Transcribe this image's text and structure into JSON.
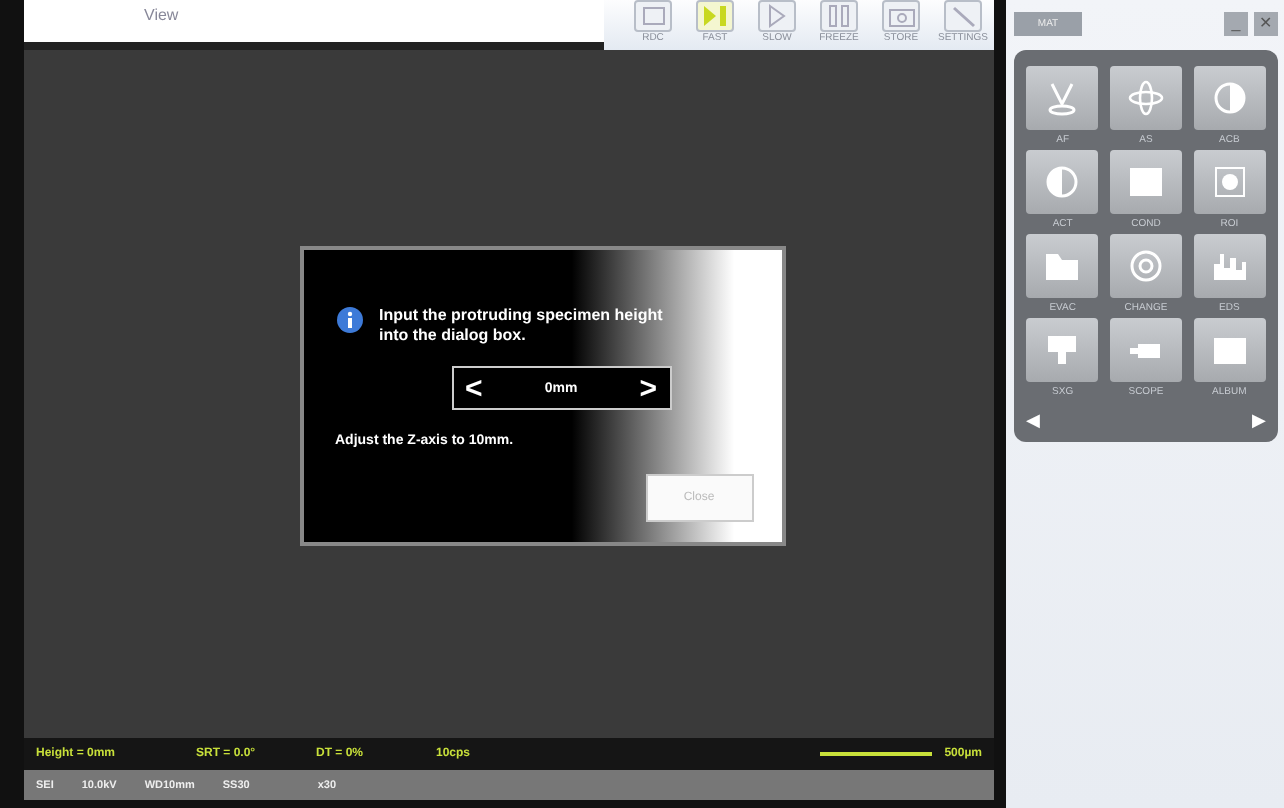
{
  "view_tab": {
    "label": "View"
  },
  "toolbar": [
    {
      "label": "RDC",
      "selected": false
    },
    {
      "label": "FAST",
      "selected": true
    },
    {
      "label": "SLOW",
      "selected": false
    },
    {
      "label": "FREEZE",
      "selected": false
    },
    {
      "label": "STORE",
      "selected": false
    },
    {
      "label": "SETTINGS",
      "selected": false
    }
  ],
  "dialog": {
    "message": "Input the protruding specimen height into the dialog box.",
    "prev": "<",
    "value": "0mm",
    "next": ">",
    "instruction": "Adjust the Z-axis to 10mm.",
    "close": {
      "label": "Close",
      "disabled": true
    }
  },
  "status": [
    "Height = 0mm",
    "SRT = 0.0°",
    "DT = 0%",
    "10cps"
  ],
  "scale": "500µm",
  "info": [
    "SEI",
    "10.0kV",
    "WD10mm",
    "SS30",
    "x30"
  ],
  "panel": {
    "label": "MAT",
    "minimize": "_",
    "close": "✕",
    "tiles": [
      {
        "label": "AF"
      },
      {
        "label": "AS"
      },
      {
        "label": "ACB"
      },
      {
        "label": "ACT"
      },
      {
        "label": "COND"
      },
      {
        "label": "ROI"
      },
      {
        "label": "EVAC"
      },
      {
        "label": "CHANGE"
      },
      {
        "label": "EDS"
      },
      {
        "label": "SXG"
      },
      {
        "label": "SCOPE"
      },
      {
        "label": "ALBUM"
      }
    ],
    "prev": "◀",
    "next": "▶"
  }
}
